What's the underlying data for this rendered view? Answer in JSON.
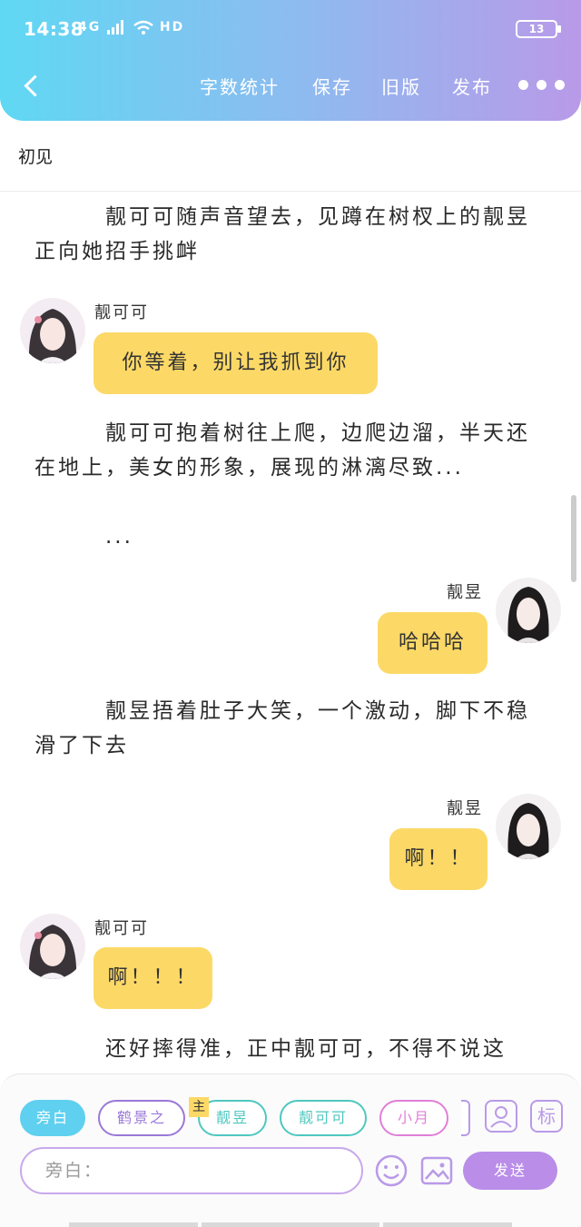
{
  "status_bar": {
    "time": "14:38",
    "signal": "4G",
    "network": "HD",
    "battery": "13"
  },
  "toolbar": {
    "word_count": "字数统计",
    "save": "保存",
    "old_version": "旧版",
    "publish": "发布"
  },
  "chapter_title": "初见",
  "story": {
    "narration_1": "靓可可随声音望去，见蹲在树杈上的靓昱正向她招手挑衅",
    "msg_1": {
      "name": "靓可可",
      "text": "你等着，别让我抓到你"
    },
    "narration_2": "靓可可抱着树往上爬，边爬边溜，半天还在地上，美女的形象，展现的淋漓尽致...",
    "narration_3": "...",
    "msg_2": {
      "name": "靓昱",
      "text": "哈哈哈"
    },
    "narration_4": "靓昱捂着肚子大笑，一个激动，脚下不稳滑了下去",
    "msg_3": {
      "name": "靓昱",
      "text": "啊！！"
    },
    "msg_4": {
      "name": "靓可可",
      "text": "啊！！！"
    },
    "narration_5": "还好摔得准，正中靓可可，不得不说这"
  },
  "characters": {
    "narrator": "旁白",
    "c1": "鹤景之",
    "c2": "靓昱",
    "c2_badge": "主",
    "c3": "靓可可",
    "c4": "小月",
    "tag_button": "标"
  },
  "composer": {
    "placeholder": "旁白：",
    "send": "发送"
  },
  "colors": {
    "accent_start": "#5fd8f3",
    "accent_end": "#b99ae8",
    "bubble": "#fcd967",
    "send": "#b98de8"
  }
}
